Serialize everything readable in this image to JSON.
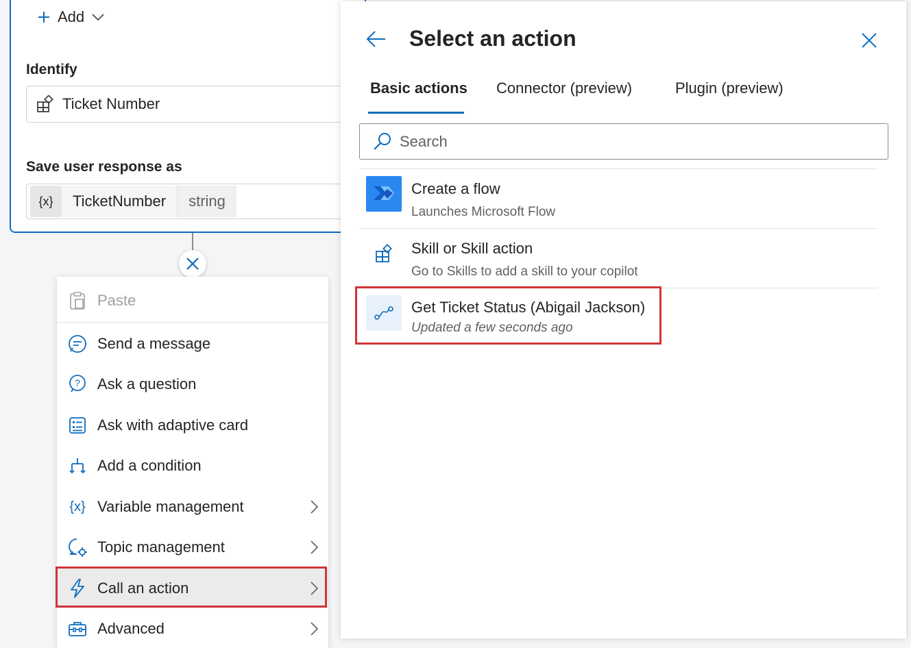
{
  "node": {
    "add_label": "Add",
    "identify_label": "Identify",
    "identify_value": "Ticket Number",
    "save_label": "Save user response as",
    "var_icon": "{x}",
    "var_name": "TicketNumber",
    "var_type": "string"
  },
  "menu": {
    "items": [
      {
        "label": "Paste",
        "icon": "paste-icon"
      },
      {
        "label": "Send a message",
        "icon": "message-icon"
      },
      {
        "label": "Ask a question",
        "icon": "question-icon"
      },
      {
        "label": "Ask with adaptive card",
        "icon": "adaptive-card-icon"
      },
      {
        "label": "Add a condition",
        "icon": "condition-icon"
      },
      {
        "label": "Variable management",
        "icon": "variable-icon",
        "var_glyph": "{x}"
      },
      {
        "label": "Topic management",
        "icon": "topic-icon"
      },
      {
        "label": "Call an action",
        "icon": "lightning-icon"
      },
      {
        "label": "Advanced",
        "icon": "toolbox-icon"
      }
    ]
  },
  "panel": {
    "title": "Select an action",
    "tabs": [
      "Basic actions",
      "Connector (preview)",
      "Plugin (preview)"
    ],
    "search_placeholder": "Search",
    "actions": [
      {
        "title": "Create a flow",
        "subtitle": "Launches Microsoft Flow",
        "icon": "power-automate-icon"
      },
      {
        "title": "Skill or Skill action",
        "subtitle": "Go to Skills to add a skill to your copilot",
        "icon": "skill-icon"
      },
      {
        "title": "Get Ticket Status (Abigail Jackson)",
        "subtitle": "Updated a few seconds ago",
        "icon": "flow-icon"
      }
    ]
  },
  "colors": {
    "accent": "#0f6cbd",
    "highlight": "#d13438",
    "flow_icon_bg": "#2b88f0"
  }
}
